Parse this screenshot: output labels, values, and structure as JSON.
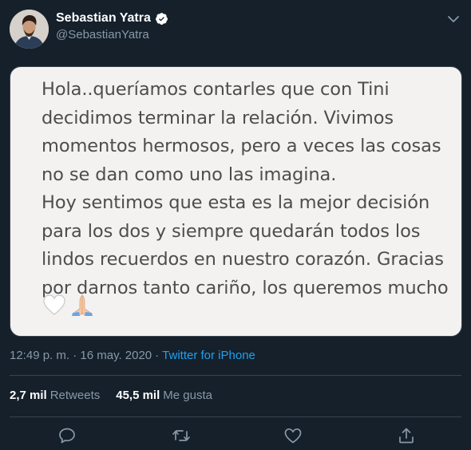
{
  "tweet": {
    "author_name": "Sebastian Yatra",
    "handle": "@SebastianYatra",
    "timestamp": "12:49 p. m. · 16 may. 2020",
    "separator": "·",
    "source": "Twitter for iPhone"
  },
  "media": {
    "text": "Hola..queríamos contarles que con Tini\ndecidimos terminar la relación. Vivimos\nmomentos hermosos, pero a veces las cosas\nno se dan como uno las imagina.\nHoy sentimos que esta es la mejor decisión\npara los dos y siempre quedarán todos los\nlindos recuerdos en nuestro corazón. Gracias\npor darnos tanto cariño, los queremos mucho"
  },
  "stats": {
    "retweets_value": "2,7 mil",
    "retweets_label": "Retweets",
    "likes_value": "45,5 mil",
    "likes_label": "Me gusta"
  },
  "icons": {
    "verified": "verified-badge-icon",
    "caret": "chevron-down-icon",
    "reply": "reply-icon",
    "retweet": "retweet-icon",
    "like": "heart-icon",
    "share": "share-icon",
    "white_heart": "white-heart-emoji",
    "praying_hands": "praying-hands-emoji"
  },
  "colors": {
    "background": "#15202b",
    "accent": "#1da1f2",
    "secondary_text": "#8899a6",
    "border": "#38444d",
    "media_background": "#f3f2f1",
    "media_text": "#4d4d4d"
  }
}
